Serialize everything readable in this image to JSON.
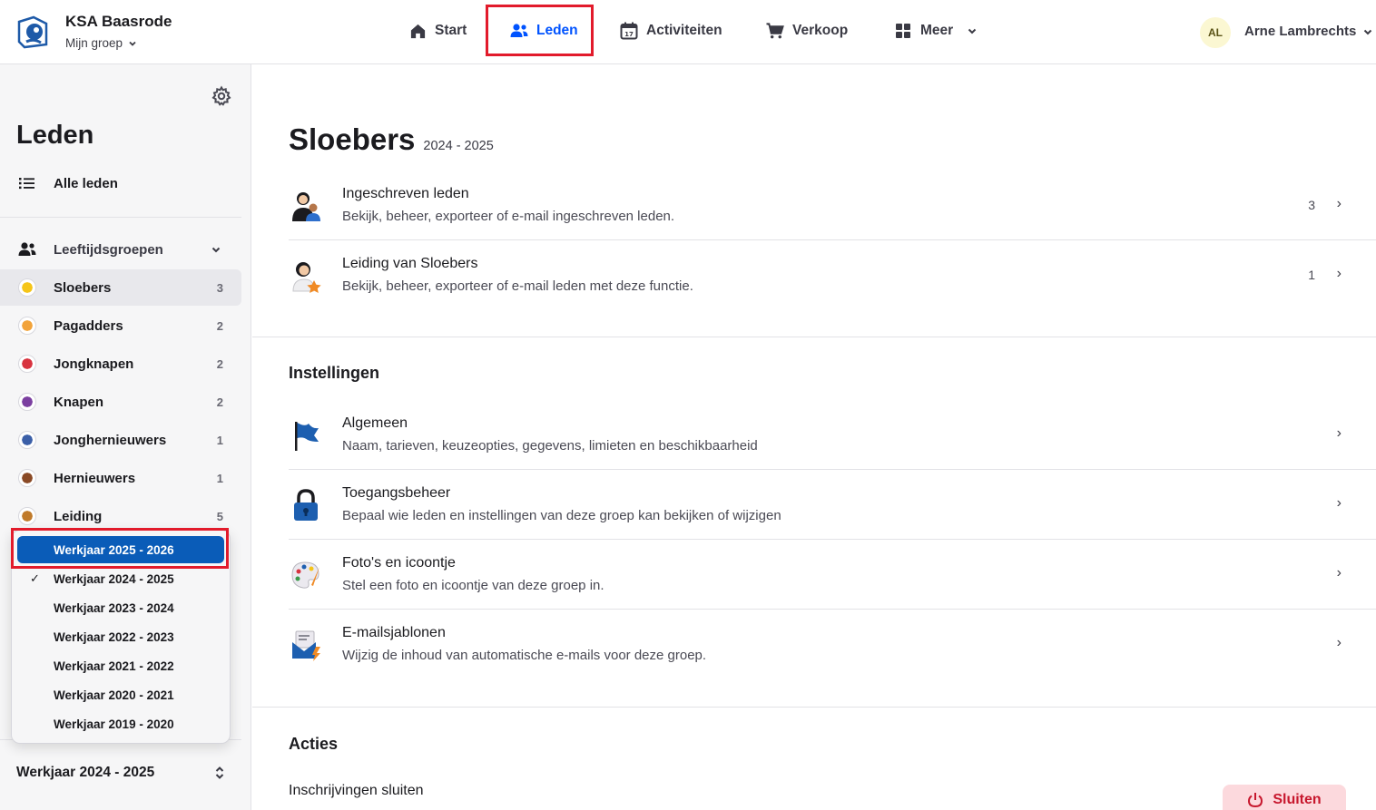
{
  "header": {
    "org_name": "KSA Baasrode",
    "org_sub": "Mijn groep",
    "nav": [
      {
        "label": "Start",
        "icon": "home-icon"
      },
      {
        "label": "Leden",
        "icon": "users-icon",
        "active": true
      },
      {
        "label": "Activiteiten",
        "icon": "calendar-icon"
      },
      {
        "label": "Verkoop",
        "icon": "cart-icon"
      },
      {
        "label": "Meer",
        "icon": "grid-icon"
      }
    ],
    "user_initials": "AL",
    "user_name": "Arne Lambrechts"
  },
  "sidebar": {
    "title": "Leden",
    "all_members": "Alle leden",
    "groups_label": "Leeftijdsgroepen",
    "groups": [
      {
        "name": "Sloebers",
        "count": "3",
        "color": "#f5c518"
      },
      {
        "name": "Pagadders",
        "count": "2",
        "color": "#f2a33a"
      },
      {
        "name": "Jongknapen",
        "count": "2",
        "color": "#d8333f"
      },
      {
        "name": "Knapen",
        "count": "2",
        "color": "#7b3fa0"
      },
      {
        "name": "Jonghernieuwers",
        "count": "1",
        "color": "#3b5fa8"
      },
      {
        "name": "Hernieuwers",
        "count": "1",
        "color": "#8a4a26"
      },
      {
        "name": "Leiding",
        "count": "5",
        "color": "#c07a2a"
      }
    ],
    "year_selected": "Werkjaar 2024 - 2025"
  },
  "dropdown": {
    "items": [
      {
        "label": "Werkjaar 2025 - 2026",
        "hovered": true,
        "checked": false
      },
      {
        "label": "Werkjaar 2024 - 2025",
        "hovered": false,
        "checked": true
      },
      {
        "label": "Werkjaar 2023 - 2024",
        "hovered": false,
        "checked": false
      },
      {
        "label": "Werkjaar 2022 - 2023",
        "hovered": false,
        "checked": false
      },
      {
        "label": "Werkjaar 2021 - 2022",
        "hovered": false,
        "checked": false
      },
      {
        "label": "Werkjaar 2020 - 2021",
        "hovered": false,
        "checked": false
      },
      {
        "label": "Werkjaar 2019 - 2020",
        "hovered": false,
        "checked": false
      }
    ],
    "check_glyph": "✓"
  },
  "main": {
    "title": "Sloebers",
    "period": "2024 - 2025",
    "members": [
      {
        "title": "Ingeschreven leden",
        "desc": "Bekijk, beheer, exporteer of e-mail ingeschreven leden.",
        "count": "3"
      },
      {
        "title": "Leiding van Sloebers",
        "desc": "Bekijk, beheer, exporteer of e-mail leden met deze functie.",
        "count": "1"
      }
    ],
    "settings_title": "Instellingen",
    "settings": [
      {
        "title": "Algemeen",
        "desc": "Naam, tarieven, keuzeopties, gegevens, limieten en beschikbaarheid"
      },
      {
        "title": "Toegangsbeheer",
        "desc": "Bepaal wie leden en instellingen van deze groep kan bekijken of wijzigen"
      },
      {
        "title": "Foto's en icoontje",
        "desc": "Stel een foto en icoontje van deze groep in."
      },
      {
        "title": "E-mailsjablonen",
        "desc": "Wijzig de inhoud van automatische e-mails voor deze groep."
      }
    ],
    "actions_title": "Acties",
    "action_close_title": "Inschrijvingen sluiten",
    "close_button": "Sluiten",
    "chevron": "›"
  }
}
